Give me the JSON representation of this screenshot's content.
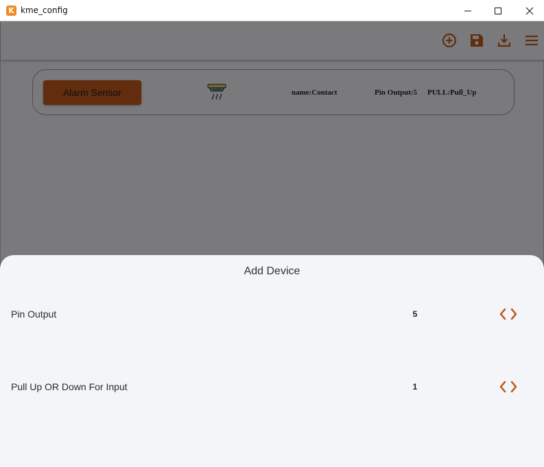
{
  "window": {
    "title": "kme_config",
    "logo_letter": "K"
  },
  "appbar": {
    "icons": [
      "add-circle-icon",
      "save-icon",
      "download-icon",
      "menu-icon"
    ],
    "accent": "#c25a1d"
  },
  "device_card": {
    "type_label": "Alarm Sensor",
    "icon": "smoke-detector-icon",
    "name_text": "name:Contact",
    "pin_text": "Pin Output:5",
    "pull_text": "PULL:Pull_Up"
  },
  "sheet": {
    "title": "Add Device",
    "rows": [
      {
        "label": "Pin Output",
        "value": "5"
      },
      {
        "label": "Pull Up OR Down For Input",
        "value": "1"
      }
    ]
  }
}
